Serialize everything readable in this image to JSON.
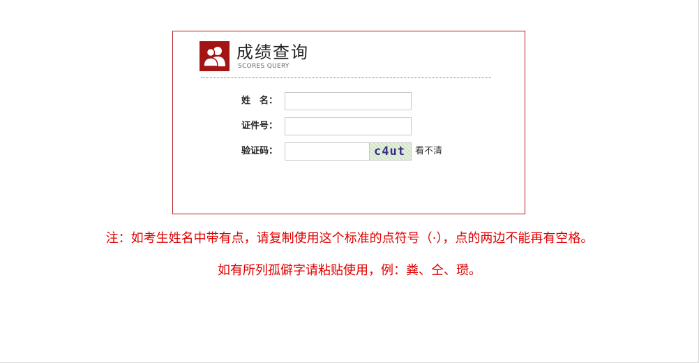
{
  "header": {
    "title": "成绩查询",
    "subtitle": "SCORES QUERY",
    "icon": "users-icon",
    "accent_color": "#a31515"
  },
  "form": {
    "name_label": "姓　名：",
    "name_value": "",
    "id_label": "证件号：",
    "id_value": "",
    "captcha_label": "验证码：",
    "captcha_value": "",
    "captcha_image_text": "c4ut",
    "captcha_refresh_label": "看不清"
  },
  "notices": {
    "line1": "注：如考生姓名中带有点，请复制使用这个标准的点符号（·），点的两边不能再有空格。",
    "line2": "如有所列孤僻字请粘贴使用，例：粪、仝、瓒。",
    "color": "#e00000"
  }
}
